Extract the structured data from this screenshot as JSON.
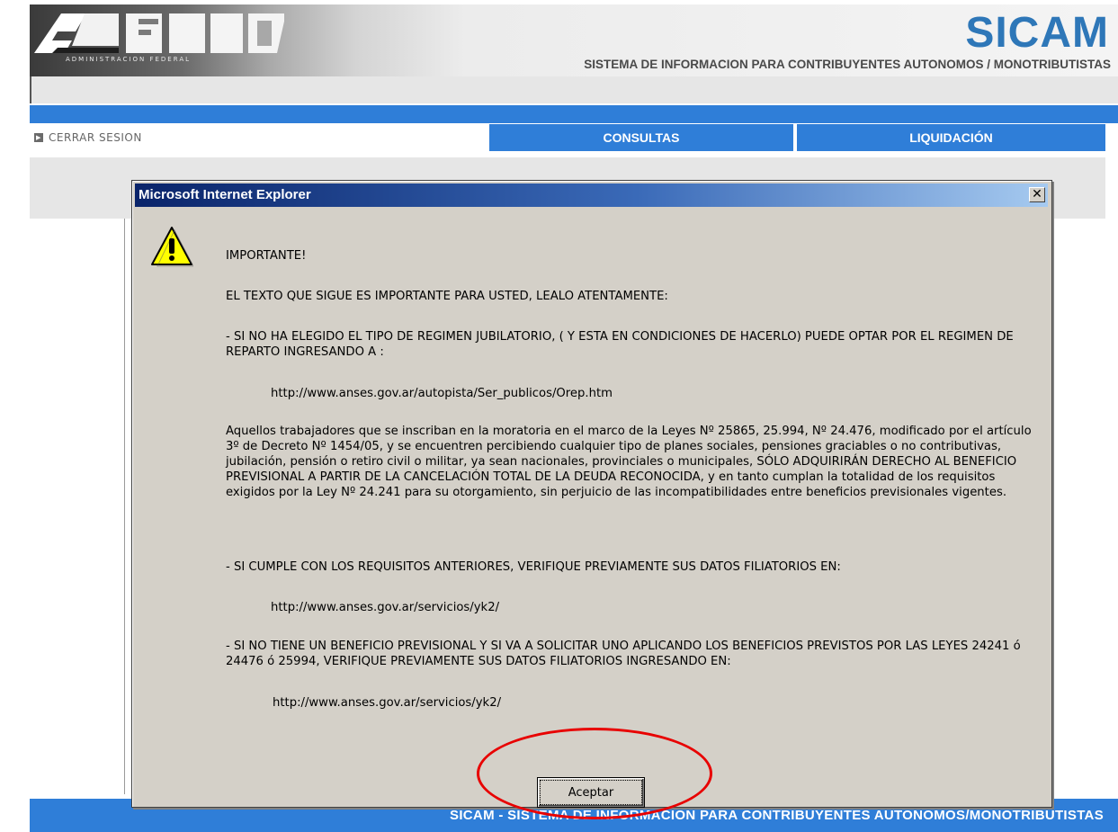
{
  "header": {
    "logo_text": "AFIP",
    "logo_subtext": "ADMINISTRACION FEDERAL",
    "brand": "SICAM",
    "tagline": "SISTEMA DE INFORMACION PARA CONTRIBUYENTES AUTONOMOS / MONOTRIBUTISTAS"
  },
  "nav": {
    "logout_label": "CERRAR SESION",
    "tabs": [
      {
        "label": "CONSULTAS"
      },
      {
        "label": "LIQUIDACIÓN"
      }
    ]
  },
  "footer": {
    "text": "SICAM - SISTEMA DE INFORMACION PARA CONTRIBUYENTES AUTONOMOS/MONOTRIBUTISTAS"
  },
  "dialog": {
    "title": "Microsoft Internet Explorer",
    "close_glyph": "✕",
    "icon": "warning-icon",
    "lines": {
      "important": "IMPORTANTE!",
      "lead": "EL TEXTO QUE SIGUE ES IMPORTANTE PARA USTED, LEALO ATENTAMENTE:",
      "bullet1": "-   SI NO HA ELEGIDO EL TIPO DE REGIMEN JUBILATORIO, ( Y ESTA EN CONDICIONES DE HACERLO) PUEDE OPTAR POR EL REGIMEN DE REPARTO INGRESANDO A :",
      "url1": "http://www.anses.gov.ar/autopista/Ser_publicos/Orep.htm",
      "body": "Aquellos trabajadores que se inscriban en la moratoria en el marco de la Leyes Nº 25865, 25.994, Nº 24.476, modificado por el artículo 3º de  Decreto Nº 1454/05, y  se encuentren percibiendo cualquier tipo de planes sociales, pensiones graciables o no contributivas, jubilación, pensión o retiro civil o militar, ya sean nacionales, provinciales o municipales, SÓLO ADQUIRIRÁN DERECHO AL BENEFICIO PREVISIONAL A PARTIR DE LA CANCELACIÓN TOTAL DE LA DEUDA RECONOCIDA, y en tanto cumplan la totalidad de los requisitos exigidos por la Ley Nº 24.241 para su otorgamiento, sin perjuicio de las incompatibilidades entre beneficios previsionales vigentes.",
      "bullet2": "-   SI CUMPLE CON LOS REQUISITOS ANTERIORES, VERIFIQUE PREVIAMENTE SUS DATOS FILIATORIOS EN:",
      "url2": "http://www.anses.gov.ar/servicios/yk2/",
      "bullet3": "-   SI NO TIENE UN BENEFICIO PREVISIONAL Y  SI VA A SOLICITAR UNO  APLICANDO LOS BENEFICIOS PREVISTOS POR LAS LEYES 24241 ó 24476 ó 25994, VERIFIQUE PREVIAMENTE SUS DATOS FILIATORIOS INGRESANDO EN:",
      "url3": "http://www.anses.gov.ar/servicios/yk2/"
    },
    "ok_label": "Aceptar"
  },
  "colors": {
    "brand_blue": "#2f7ed8",
    "sicam_blue": "#2e77b8",
    "dialog_gray": "#d4d0c8",
    "highlight_red": "#e80000"
  }
}
